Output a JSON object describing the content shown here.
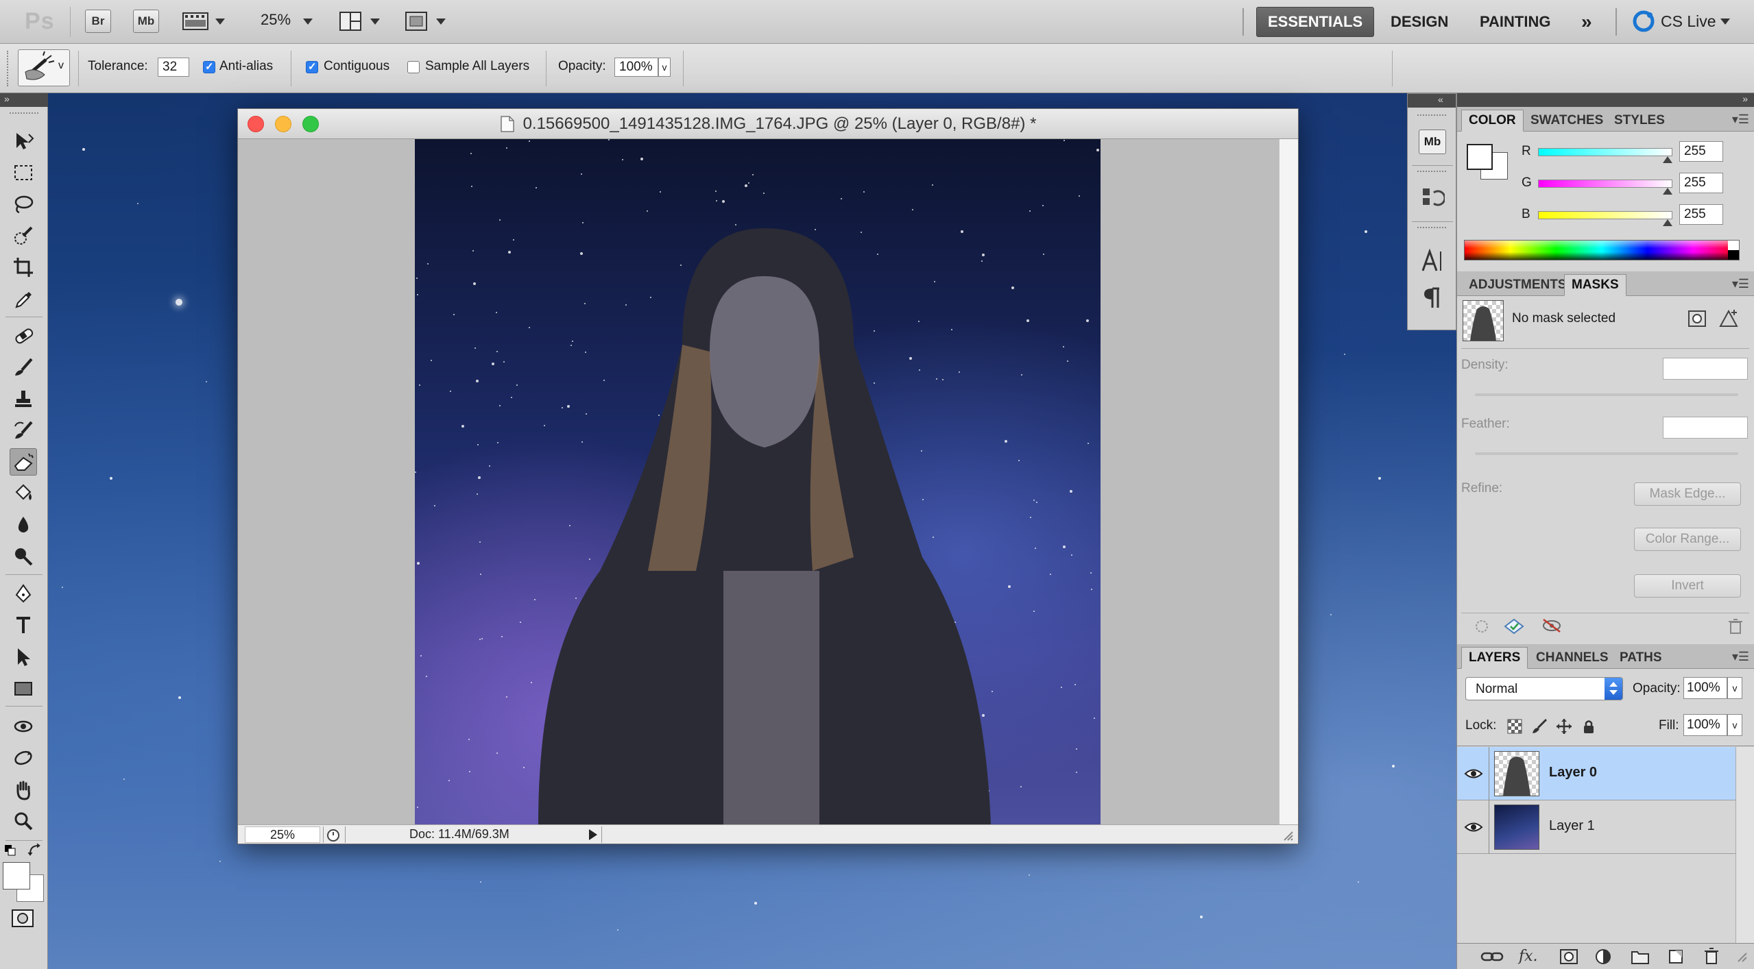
{
  "app": {
    "logo": "Ps",
    "bridge_label": "Br",
    "mini_bridge_label": "Mb",
    "zoom": "25%",
    "workspaces": [
      "ESSENTIALS",
      "DESIGN",
      "PAINTING"
    ],
    "active_workspace": "ESSENTIALS",
    "more_workspaces": "»",
    "cs_live": "CS Live"
  },
  "options": {
    "tolerance_label": "Tolerance:",
    "tolerance_value": "32",
    "anti_alias_label": "Anti-alias",
    "anti_alias_checked": true,
    "contiguous_label": "Contiguous",
    "contiguous_checked": true,
    "sample_all_label": "Sample All Layers",
    "sample_all_checked": false,
    "opacity_label": "Opacity:",
    "opacity_value": "100%"
  },
  "document": {
    "title": "0.15669500_1491435128.IMG_1764.JPG @ 25% (Layer 0, RGB/8#) *",
    "zoom": "25%",
    "doc_info": "Doc: 11.4M/69.3M"
  },
  "color_panel": {
    "tabs": [
      "COLOR",
      "SWATCHES",
      "STYLES"
    ],
    "active_tab": "COLOR",
    "r_label": "R",
    "r_value": "255",
    "g_label": "G",
    "g_value": "255",
    "b_label": "B",
    "b_value": "255"
  },
  "masks_panel": {
    "tabs": [
      "ADJUSTMENTS",
      "MASKS"
    ],
    "active_tab": "MASKS",
    "status": "No mask selected",
    "density_label": "Density:",
    "feather_label": "Feather:",
    "refine_label": "Refine:",
    "mask_edge_button": "Mask Edge...",
    "color_range_button": "Color Range...",
    "invert_button": "Invert"
  },
  "layers_panel": {
    "tabs": [
      "LAYERS",
      "CHANNELS",
      "PATHS"
    ],
    "active_tab": "LAYERS",
    "blend_mode": "Normal",
    "opacity_label": "Opacity:",
    "opacity_value": "100%",
    "lock_label": "Lock:",
    "fill_label": "Fill:",
    "fill_value": "100%",
    "layers": [
      {
        "name": "Layer 0",
        "selected": true
      },
      {
        "name": "Layer 1",
        "selected": false
      }
    ]
  },
  "colors": {
    "accent_selected_layer": "#b5d5fb",
    "traffic_close": "#fc5753",
    "traffic_min": "#fdbc40",
    "traffic_max": "#33c748"
  }
}
